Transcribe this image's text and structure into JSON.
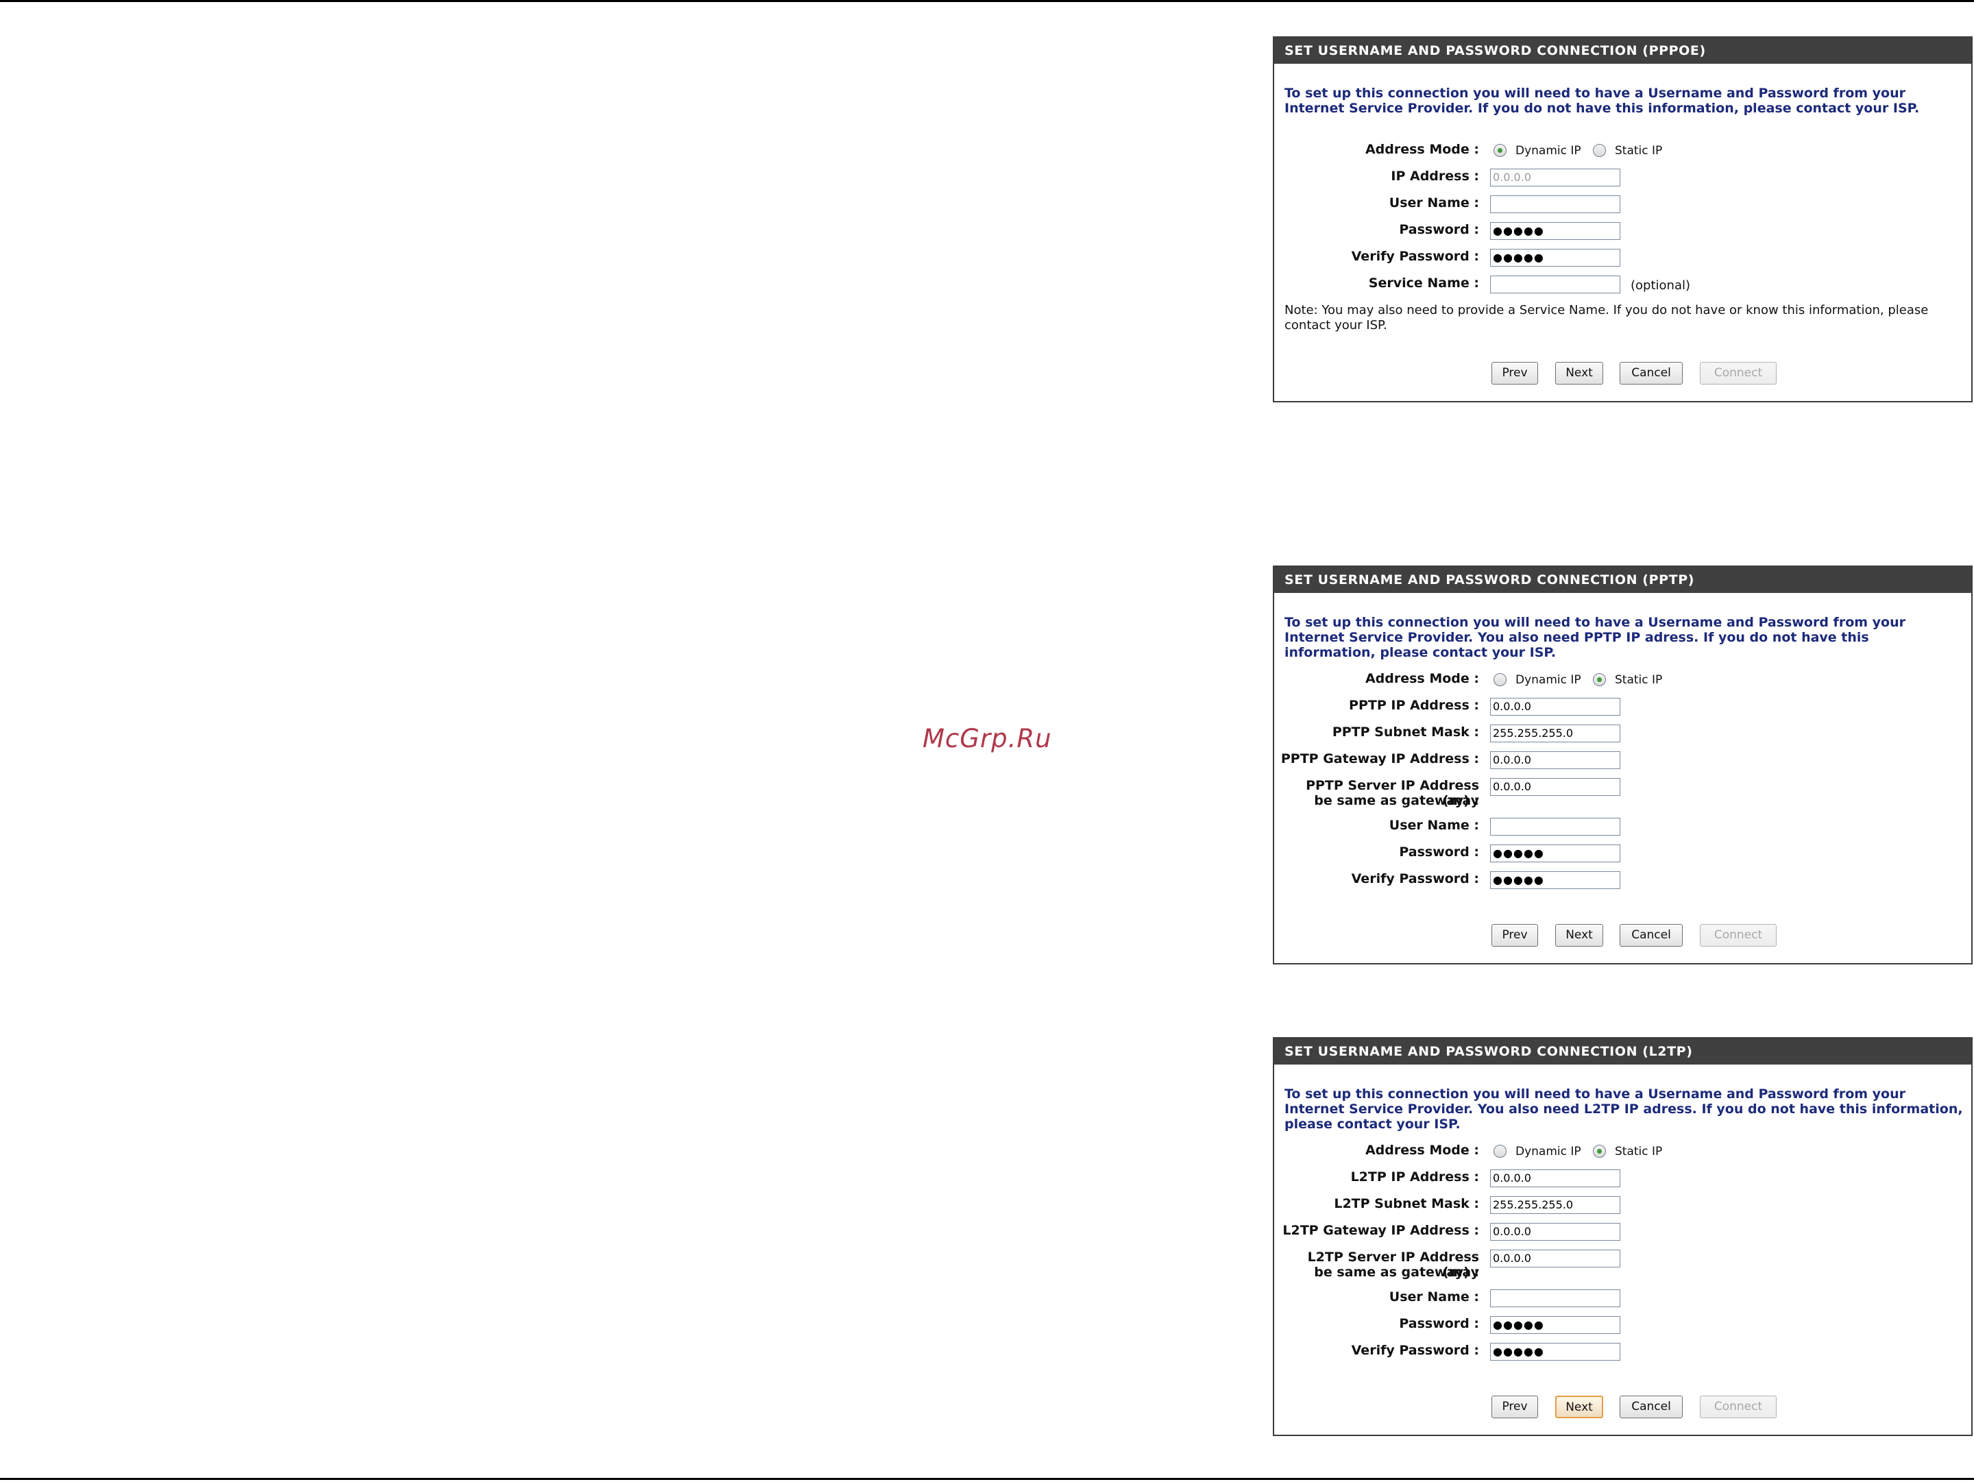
{
  "watermark": "McGrp.Ru",
  "pppoe": {
    "title": "SET USERNAME AND PASSWORD CONNECTION (PPPOE)",
    "intro": "To set up this connection you will need to have a Username and Password from your Internet Service Provider. If you do not have this information, please contact your ISP.",
    "address_mode_label": "Address Mode :",
    "dynamic_ip": "Dynamic IP",
    "static_ip": "Static IP",
    "selected_mode": "Dynamic IP",
    "ip_address_label": "IP Address :",
    "ip_address_value": "0.0.0.0",
    "user_name_label": "User Name :",
    "user_name_value": "",
    "password_label": "Password :",
    "password_value": "●●●●●",
    "verify_password_label": "Verify Password :",
    "verify_password_value": "●●●●●",
    "service_name_label": "Service Name :",
    "service_name_value": "",
    "optional": "(optional)",
    "note": "Note: You may also need to provide a Service Name. If you do not have or know this information, please contact your ISP.",
    "buttons": {
      "prev": "Prev",
      "next": "Next",
      "cancel": "Cancel",
      "connect": "Connect"
    }
  },
  "pptp": {
    "title": "SET USERNAME AND PASSWORD CONNECTION (PPTP)",
    "intro": "To set up this connection you will need to have a Username and Password from your Internet Service Provider. You also need PPTP IP adress. If you do not have this information, please contact your ISP.",
    "address_mode_label": "Address Mode :",
    "dynamic_ip": "Dynamic IP",
    "static_ip": "Static IP",
    "selected_mode": "Static IP",
    "ip_address_label": "PPTP IP Address :",
    "ip_address_value": "0.0.0.0",
    "subnet_mask_label": "PPTP Subnet Mask :",
    "subnet_mask_value": "255.255.255.0",
    "gateway_label": "PPTP Gateway IP Address :",
    "gateway_value": "0.0.0.0",
    "server_label_1": "PPTP Server IP Address (may",
    "server_label_2": "be same as gateway) :",
    "server_value": "0.0.0.0",
    "user_name_label": "User Name :",
    "user_name_value": "",
    "password_label": "Password :",
    "password_value": "●●●●●",
    "verify_password_label": "Verify Password :",
    "verify_password_value": "●●●●●",
    "buttons": {
      "prev": "Prev",
      "next": "Next",
      "cancel": "Cancel",
      "connect": "Connect"
    }
  },
  "l2tp": {
    "title": "SET USERNAME AND PASSWORD CONNECTION (L2TP)",
    "intro": "To set up this connection you will need to have a Username and Password from your Internet Service Provider. You also need L2TP IP adress. If you do not have this information, please contact your ISP.",
    "address_mode_label": "Address Mode :",
    "dynamic_ip": "Dynamic IP",
    "static_ip": "Static IP",
    "selected_mode": "Static IP",
    "ip_address_label": "L2TP IP Address :",
    "ip_address_value": "0.0.0.0",
    "subnet_mask_label": "L2TP Subnet Mask :",
    "subnet_mask_value": "255.255.255.0",
    "gateway_label": "L2TP Gateway IP Address :",
    "gateway_value": "0.0.0.0",
    "server_label_1": "L2TP Server IP Address (may",
    "server_label_2": "be same as gateway) :",
    "server_value": "0.0.0.0",
    "user_name_label": "User Name :",
    "user_name_value": "",
    "password_label": "Password :",
    "password_value": "●●●●●",
    "verify_password_label": "Verify Password :",
    "verify_password_value": "●●●●●",
    "buttons": {
      "prev": "Prev",
      "next": "Next",
      "cancel": "Cancel",
      "connect": "Connect"
    }
  }
}
